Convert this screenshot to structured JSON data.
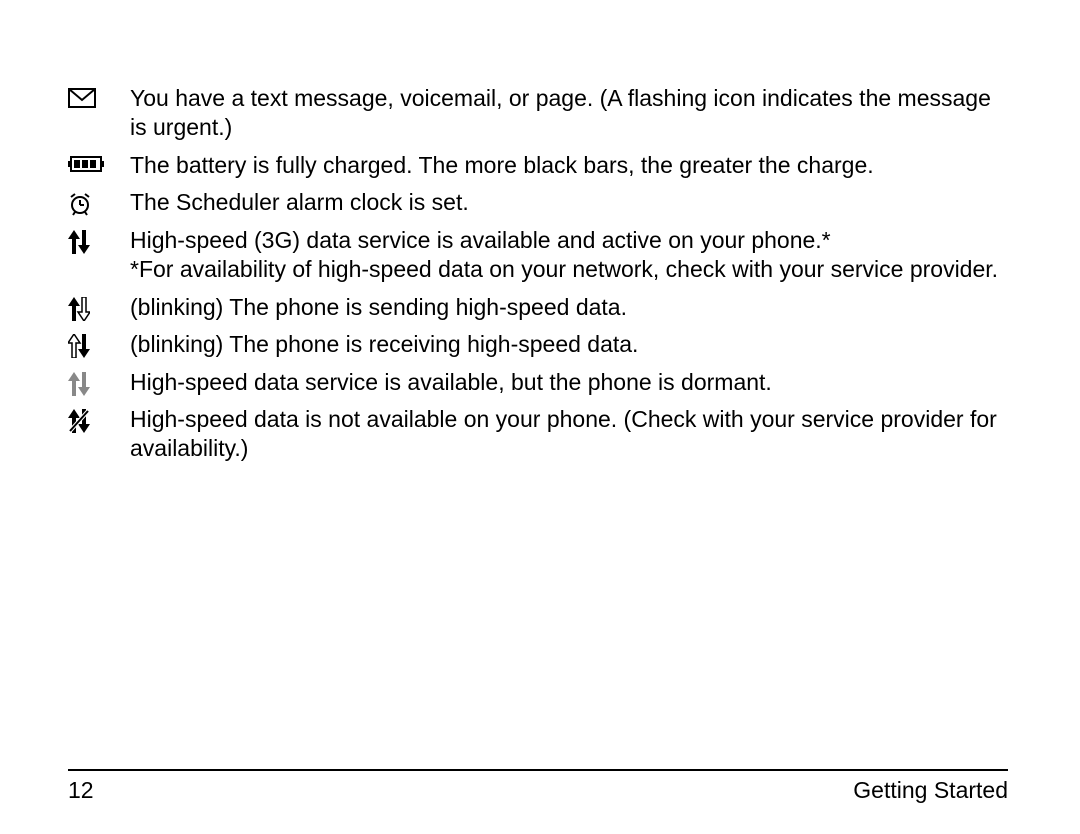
{
  "items": [
    {
      "text": "You have a text message, voicemail, or page. (A flashing icon indicates the message is urgent.)"
    },
    {
      "text": "The battery is fully charged. The more black bars, the greater the charge."
    },
    {
      "text": "The Scheduler alarm clock is set."
    },
    {
      "text": "High-speed (3G) data service is available and active on your phone.*",
      "extra": "*For availability of high-speed data on your network, check with your service provider."
    },
    {
      "text": "(blinking) The phone is sending high-speed data."
    },
    {
      "text": "(blinking) The phone is receiving high-speed data."
    },
    {
      "text": "High-speed data service is available, but the phone is dormant."
    },
    {
      "text": "High-speed data is not available on your phone. (Check with your service provider for availability.)"
    }
  ],
  "footer": {
    "page": "12",
    "section": "Getting Started"
  }
}
